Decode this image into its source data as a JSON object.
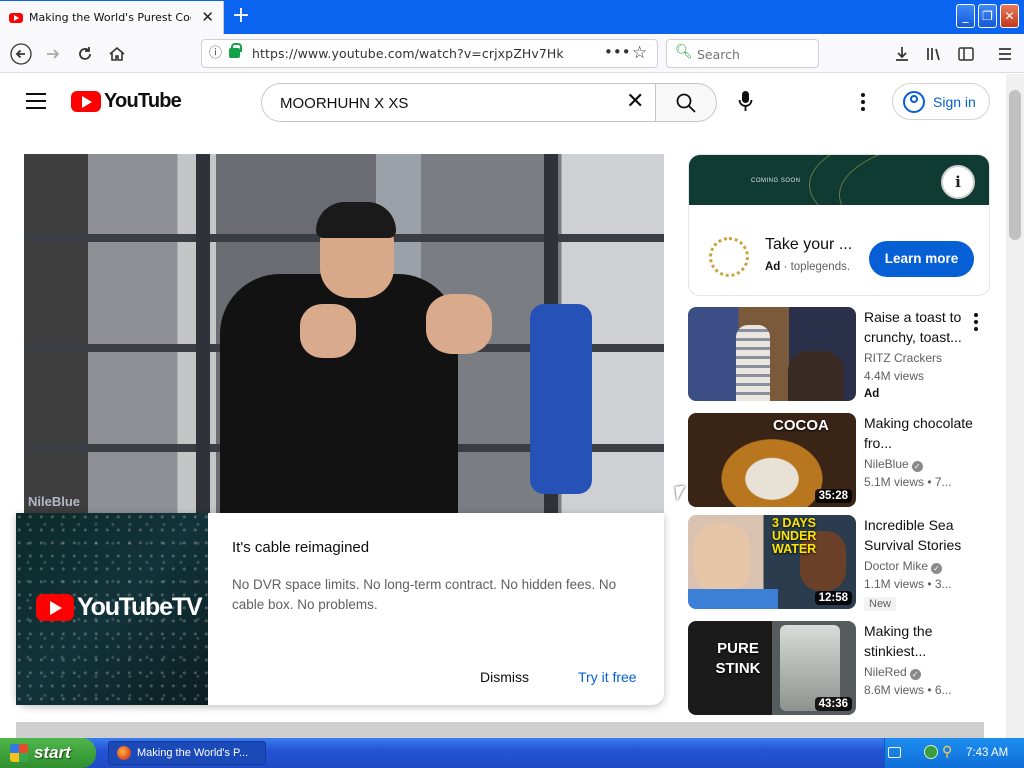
{
  "browser": {
    "tab_title": "Making the World's Purest Cookie",
    "tab_close": "✕",
    "new_tab": "+",
    "url": "https://www.youtube.com/watch?v=crjxpZHv7Hk",
    "search_placeholder": "Search",
    "window_min": "_",
    "window_max": "❐",
    "window_close": "✕"
  },
  "youtube": {
    "logo_text": "YouTube",
    "search_query": "MOORHUHN X XS",
    "sign_in": "Sign in"
  },
  "player": {
    "watermark": "NileBlue"
  },
  "ytv_promo": {
    "logo_text": "YouTubeTV",
    "title": "It's cable reimagined",
    "description": "No DVR space limits. No long-term contract. No hidden fees. No cable box. No problems.",
    "dismiss": "Dismiss",
    "try": "Try it free"
  },
  "ad": {
    "banner_text": "COMING SOON",
    "title": "Take your ...",
    "label": "Ad",
    "advertiser": "toplegends.",
    "cta": "Learn more"
  },
  "recommendations": [
    {
      "title": "Raise a toast to crunchy, toast...",
      "channel": "RITZ Crackers",
      "views": "4.4M views",
      "badge": "Ad",
      "duration": ""
    },
    {
      "title": "Making chocolate fro...",
      "channel": "NileBlue",
      "views": "5.1M views  •  7...",
      "thumb_text": "COCOA",
      "duration": "35:28"
    },
    {
      "title": "Incredible Sea Survival Stories",
      "channel": "Doctor Mike",
      "views": "1.1M views  •  3...",
      "badge": "New",
      "thumb_text": "3 DAYS UNDER WATER",
      "duration": "12:58"
    },
    {
      "title": "Making the stinkiest...",
      "channel": "NileRed",
      "views": "8.6M views  •  6...",
      "thumb_text": "PURE STINK",
      "duration": "43:36"
    }
  ],
  "taskbar": {
    "start": "start",
    "window_item": "Making the World's P...",
    "clock": "7:43 AM"
  },
  "colors": {
    "youtube_red": "#ff0000",
    "link_blue": "#065fd4",
    "xp_taskbar": "#2454d4",
    "xp_start": "#3aa347"
  }
}
